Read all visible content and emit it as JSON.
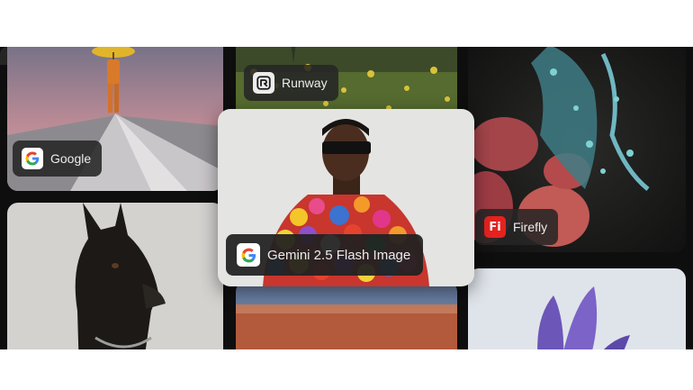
{
  "gallery": {
    "chips": {
      "google": "Google",
      "runway": "Runway",
      "firefly": "Firefly",
      "gemini": "Gemini 2.5 Flash Image"
    },
    "icons": {
      "google": "google-g-icon",
      "runway": "runway-logo-icon",
      "firefly": "firefly-logo-icon",
      "firefly_mark": "Fi"
    }
  },
  "colors": {
    "background": "#0e0e0e",
    "chip": "#262626",
    "firefly_red": "#e6221f"
  }
}
